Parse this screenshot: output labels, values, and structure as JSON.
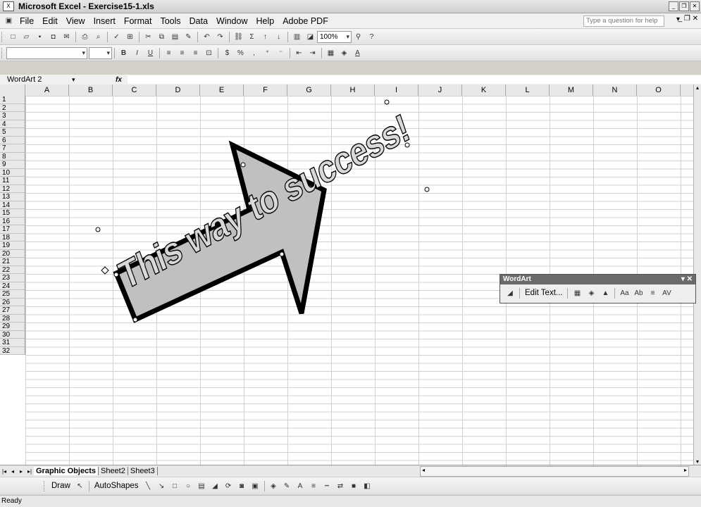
{
  "window": {
    "title": "Microsoft Excel - Exercise15-1.xls"
  },
  "menu": {
    "items": [
      "File",
      "Edit",
      "View",
      "Insert",
      "Format",
      "Tools",
      "Data",
      "Window",
      "Help",
      "Adobe PDF"
    ],
    "help_placeholder": "Type a question for help"
  },
  "standard_toolbar": {
    "zoom": "100%"
  },
  "formula_bar": {
    "name_box": "WordArt 2",
    "fx": "fx"
  },
  "columns": [
    "A",
    "B",
    "C",
    "D",
    "E",
    "F",
    "G",
    "H",
    "I",
    "J",
    "K",
    "L",
    "M",
    "N",
    "O"
  ],
  "rows": [
    "1",
    "2",
    "3",
    "4",
    "5",
    "6",
    "7",
    "8",
    "9",
    "10",
    "11",
    "12",
    "13",
    "14",
    "15",
    "16",
    "17",
    "18",
    "19",
    "20",
    "21",
    "22",
    "23",
    "24",
    "25",
    "26",
    "27",
    "28",
    "29",
    "30",
    "31",
    "32"
  ],
  "wordart": {
    "text": "This way to success!"
  },
  "wordart_toolbar": {
    "title": "WordArt",
    "edit_text": "Edit Text..."
  },
  "tabs": {
    "active": "Graphic Objects",
    "others": [
      "Sheet2",
      "Sheet3"
    ]
  },
  "draw_toolbar": {
    "draw": "Draw",
    "autoshapes": "AutoShapes"
  },
  "status": {
    "text": "Ready"
  },
  "colors": {
    "accent": "#6b6b6b",
    "arrow_fill": "#c0c0c0"
  }
}
